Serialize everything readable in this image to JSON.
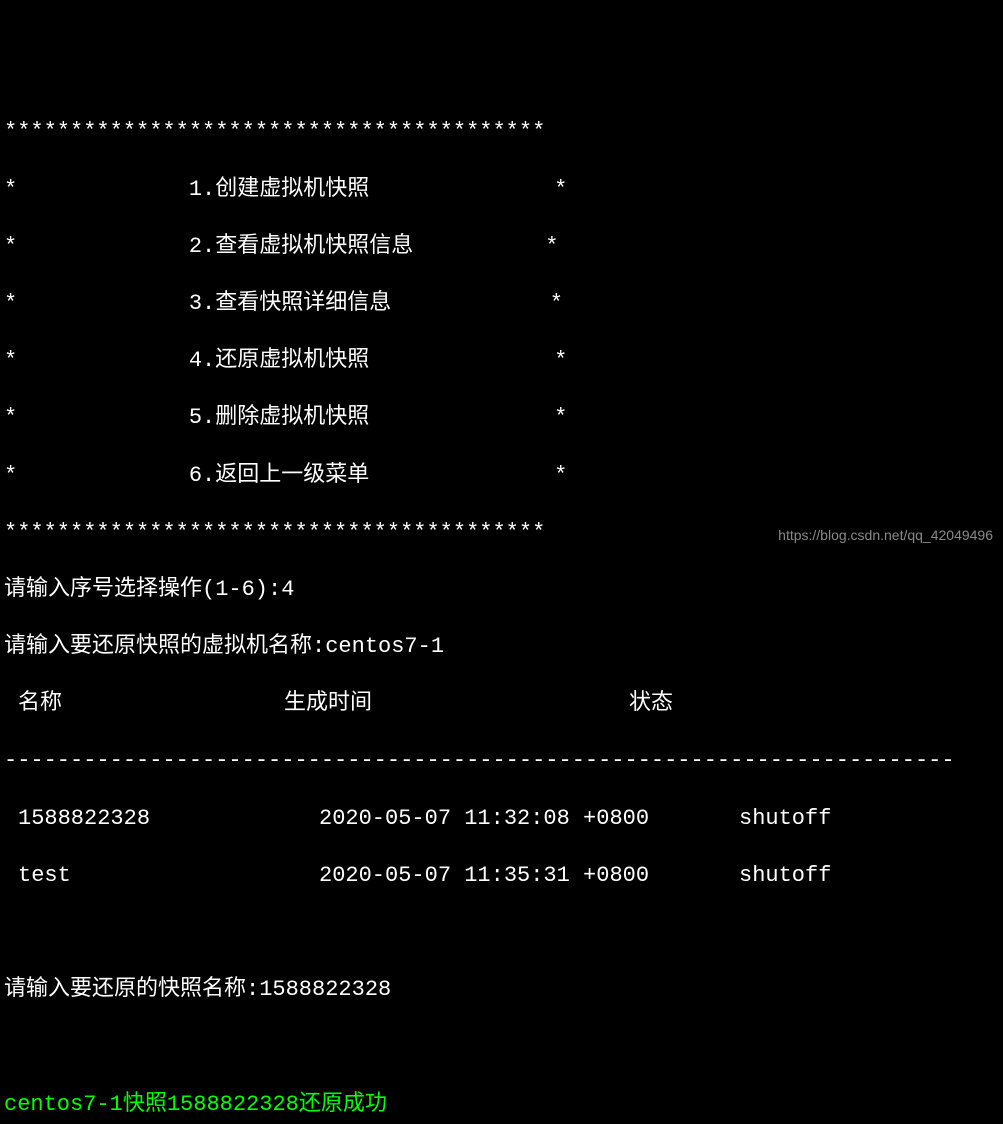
{
  "border_top": "*****************************************",
  "menu": {
    "items": [
      {
        "num": "1",
        "label": "创建虚拟机快照"
      },
      {
        "num": "2",
        "label": "查看虚拟机快照信息"
      },
      {
        "num": "3",
        "label": "查看快照详细信息"
      },
      {
        "num": "4",
        "label": "还原虚拟机快照"
      },
      {
        "num": "5",
        "label": "删除虚拟机快照"
      },
      {
        "num": "6",
        "label": "返回上一级菜单"
      }
    ]
  },
  "border_bottom": "*****************************************",
  "prompts": {
    "select_op": "请输入序号选择操作(1-6):",
    "select_op_value": "4",
    "vm_name_prompt": "请输入要还原快照的虚拟机名称:",
    "vm_name_value": "centos7-1",
    "snapshot_prompt": "请输入要还原的快照名称:",
    "snapshot_value": "1588822328"
  },
  "table": {
    "headers": {
      "name": "名称",
      "time": "生成时间",
      "state": "状态"
    },
    "divider": "------------------------------------------------------------------------",
    "rows": [
      {
        "name": "1588822328",
        "time": "2020-05-07 11:32:08 +0800",
        "state": "shutoff"
      },
      {
        "name": "test",
        "time": "2020-05-07 11:35:31 +0800",
        "state": "shutoff"
      }
    ]
  },
  "result": {
    "vm": "centos7-1",
    "mid": "快照",
    "snap": "1588822328",
    "suffix": "还原成功"
  },
  "watermark": "https://blog.csdn.net/qq_42049496"
}
